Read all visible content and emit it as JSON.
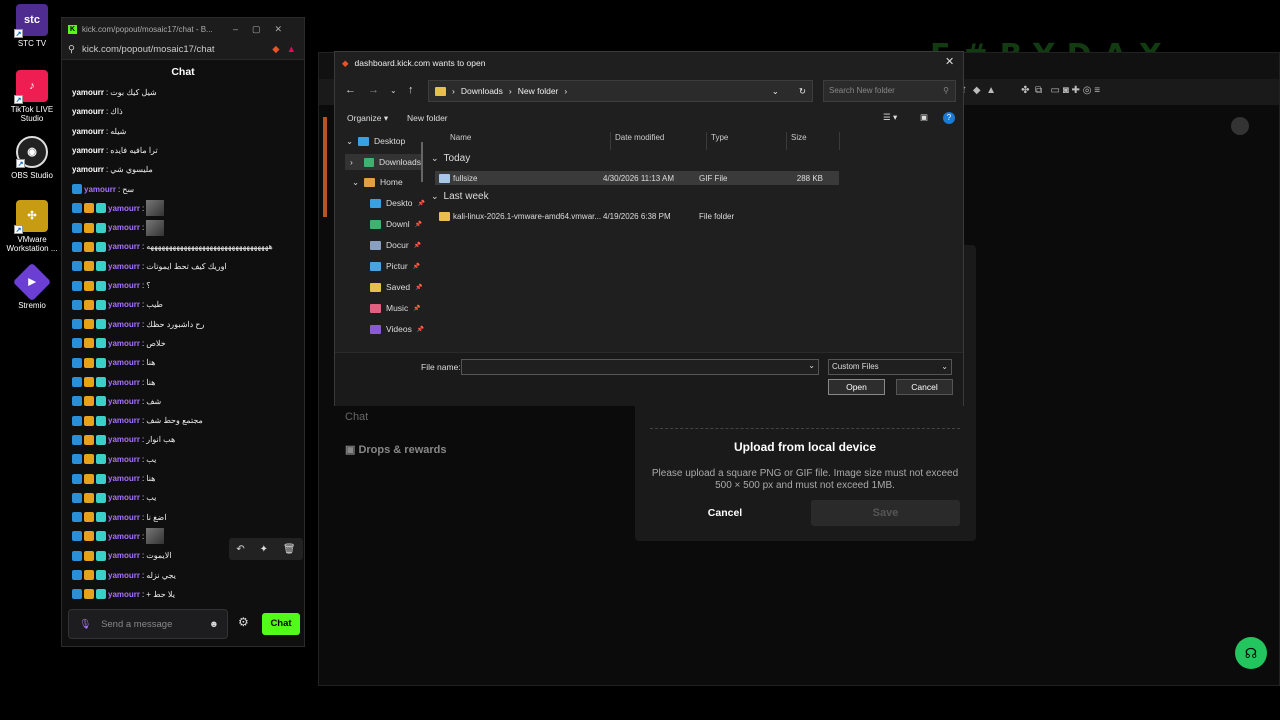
{
  "desktop": {
    "icons": [
      {
        "label": "STC TV",
        "color": "#4f2c8f",
        "glyph": "stc"
      },
      {
        "label": "TikTok LIVE Studio",
        "color": "#ee1d52",
        "glyph": "♪"
      },
      {
        "label": "OBS Studio",
        "color": "#222222",
        "glyph": "◉"
      },
      {
        "label": "VMware Workstation ...",
        "color": "#c79b12",
        "glyph": "✣"
      },
      {
        "label": "Stremio",
        "color": "#6b3fd4",
        "glyph": "▶"
      }
    ]
  },
  "chat_window": {
    "title": "kick.com/popout/mosaic17/chat - B...",
    "url": "kick.com/popout/mosaic17/chat",
    "header": "Chat",
    "messages": [
      {
        "user": "yamourr",
        "text": "شيل كيك بوت",
        "badges": false
      },
      {
        "user": "yamourr",
        "text": "ذاك",
        "badges": false
      },
      {
        "user": "yamourr",
        "text": "شيله",
        "badges": false
      },
      {
        "user": "yamourr",
        "text": "ترا مافيه فايده",
        "badges": false
      },
      {
        "user": "yamourr",
        "text": "مليسوي شي",
        "badges": false
      },
      {
        "user": "yamourr",
        "text": "سح",
        "badges": "one"
      },
      {
        "user": "yamourr",
        "text": "",
        "badges": true,
        "thumb": true
      },
      {
        "user": "yamourr",
        "text": "",
        "badges": true,
        "thumb": true
      },
      {
        "user": "yamourr",
        "text": "هههههههههههههههههههههههههههههههههه",
        "badges": true
      },
      {
        "user": "yamourr",
        "text": "اوريك كيف تحط ايموتات",
        "badges": true
      },
      {
        "user": "yamourr",
        "text": "؟",
        "badges": true
      },
      {
        "user": "yamourr",
        "text": "طيب",
        "badges": true
      },
      {
        "user": "yamourr",
        "text": "رح داشبورد حظك",
        "badges": true
      },
      {
        "user": "yamourr",
        "text": "خلاص",
        "badges": true
      },
      {
        "user": "yamourr",
        "text": "هنا",
        "badges": true
      },
      {
        "user": "yamourr",
        "text": "هنا",
        "badges": true
      },
      {
        "user": "yamourr",
        "text": "شف",
        "badges": true
      },
      {
        "user": "yamourr",
        "text": "مجتمع وحط شف",
        "badges": true
      },
      {
        "user": "yamourr",
        "text": "هب انوار",
        "badges": true
      },
      {
        "user": "yamourr",
        "text": "يب",
        "badges": true
      },
      {
        "user": "yamourr",
        "text": "هنا",
        "badges": true
      },
      {
        "user": "yamourr",
        "text": "يب",
        "badges": true
      },
      {
        "user": "yamourr",
        "text": "اضغ نا",
        "badges": true
      },
      {
        "user": "yamourr",
        "text": "",
        "badges": true,
        "thumb": true
      },
      {
        "user": "yamourr",
        "text": "الايموت",
        "badges": true
      },
      {
        "user": "yamourr",
        "text": "يجي نزله",
        "badges": true
      },
      {
        "user": "yamourr",
        "text": "+ يلا حط",
        "badges": true
      }
    ],
    "input_placeholder": "Send a message",
    "send_label": "Chat",
    "username_color": "#a970ff"
  },
  "background_page": {
    "upload_title": "Upload from local device",
    "upload_desc": "Please upload a square PNG or GIF file. Image size must not exceed 500 × 500 px and must not exceed 1MB.",
    "cancel_label": "Cancel",
    "save_label": "Save",
    "sidebar": [
      "Chat",
      "Drops & rewards"
    ]
  },
  "dialog": {
    "title": "dashboard.kick.com wants to open",
    "breadcrumb": [
      "Downloads",
      "New folder"
    ],
    "search_placeholder": "Search New folder",
    "organize": "Organize",
    "new_folder": "New folder",
    "nav": [
      {
        "label": "Desktop",
        "color": "#3aa0e0",
        "pin": false
      },
      {
        "label": "Downloads",
        "color": "#3cb371",
        "pin": false
      },
      {
        "label": "Home",
        "color": "#e0a040",
        "pin": false
      },
      {
        "label": "Deskto",
        "color": "#3aa0e0",
        "pin": true
      },
      {
        "label": "Downl",
        "color": "#3cb371",
        "pin": true
      },
      {
        "label": "Docur",
        "color": "#8aa0c0",
        "pin": true
      },
      {
        "label": "Pictur",
        "color": "#4aa3df",
        "pin": true
      },
      {
        "label": "Saved",
        "color": "#e6c04a",
        "pin": true
      },
      {
        "label": "Music",
        "color": "#e06080",
        "pin": true
      },
      {
        "label": "Videos",
        "color": "#8a5ad0",
        "pin": true
      }
    ],
    "columns": [
      "Name",
      "Date modified",
      "Type",
      "Size"
    ],
    "groups": [
      {
        "name": "Today",
        "rows": [
          {
            "name": "fullsize",
            "date": "4/30/2026 11:13 AM",
            "type": "GIF File",
            "size": "288 KB",
            "selected": true
          }
        ]
      },
      {
        "name": "Last week",
        "rows": [
          {
            "name": "kali-linux-2026.1-vmware-amd64.vmwar...",
            "date": "4/19/2026 6:38 PM",
            "type": "File folder",
            "size": "",
            "selected": false
          }
        ]
      }
    ],
    "filename_label": "File name:",
    "filename_value": "",
    "filetype": "Custom Files",
    "open_label": "Open",
    "cancel_label": "Cancel"
  }
}
